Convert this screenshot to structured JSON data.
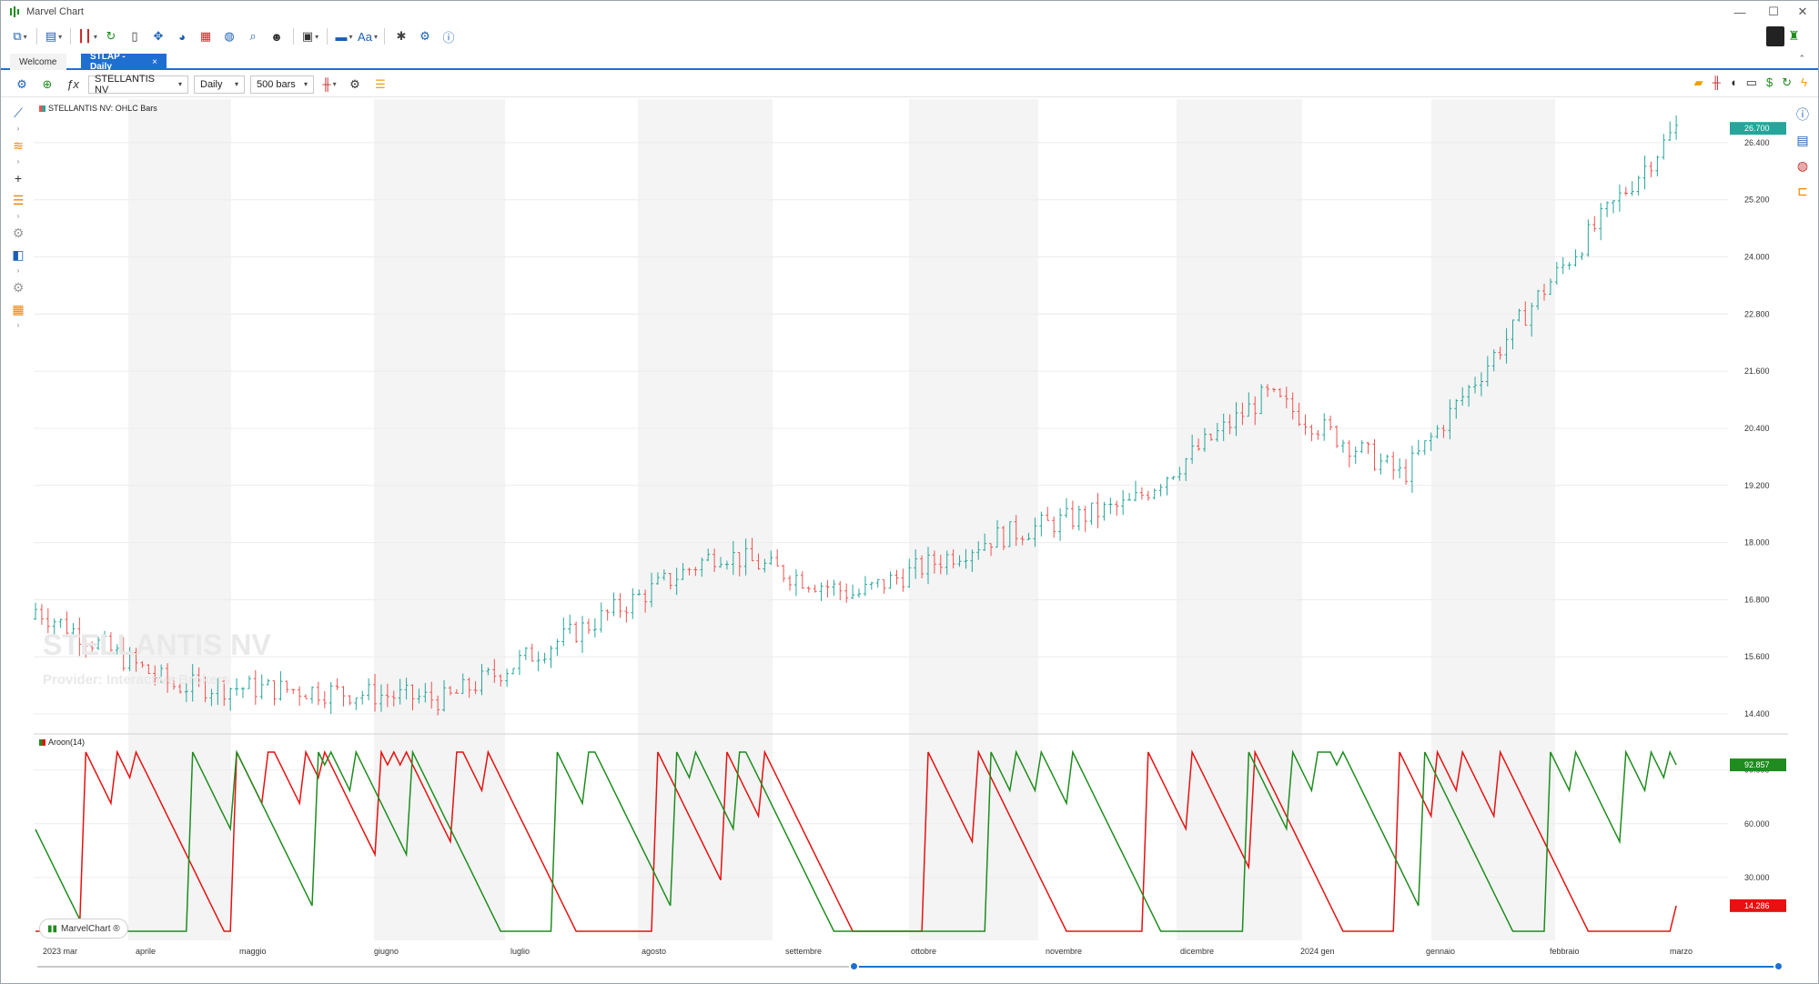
{
  "window": {
    "title": "Marvel Chart",
    "minimize_label": "—",
    "maximize_label": "☐",
    "close_label": "✕"
  },
  "toolbar": {
    "icons": [
      "tree-icon",
      "layout-icon",
      "candles-icon",
      "history-icon",
      "document-icon",
      "move-icon",
      "pie-icon",
      "calendar-icon",
      "globe-icon",
      "search-icon",
      "user-icon",
      "screen-icon",
      "bar-icon",
      "font-icon",
      "bug-icon",
      "gear-icon",
      "info-icon"
    ],
    "font_label": "Aa"
  },
  "tabs": [
    {
      "label": "Welcome",
      "active": false
    },
    {
      "label": "STLAP - Daily",
      "active": true,
      "close": "×"
    }
  ],
  "chartbar": {
    "symbol": "STELLANTIS NV",
    "timeframe": "Daily",
    "bars": "500 bars"
  },
  "price_panel": {
    "legend": "STELLANTIS NV: OHLC Bars",
    "watermark_title": "STELLANTIS NV",
    "watermark_provider": "Provider: Interactive Brokers",
    "last_price": "26.700",
    "y_ticks": [
      "26.400",
      "25.200",
      "24.000",
      "22.800",
      "21.600",
      "20.400",
      "19.200",
      "18.000",
      "16.800",
      "15.600",
      "14.400"
    ]
  },
  "indicator_panel": {
    "legend": "Aroon(14)",
    "up_value": "92.857",
    "down_value": "14.286",
    "y_ticks": [
      "90.000",
      "60.000",
      "30.000"
    ]
  },
  "x_axis": {
    "labels": [
      "2023 mar",
      "aprile",
      "maggio",
      "giugno",
      "luglio",
      "agosto",
      "settembre",
      "ottobre",
      "novembre",
      "dicembre",
      "2024 gen",
      "gennaio",
      "febbraio",
      "marzo"
    ]
  },
  "badge": {
    "label": "MarvelChart ®"
  },
  "colors": {
    "up": "#26a69a",
    "down": "#ef5350",
    "aroon_up": "#1e8c1e",
    "aroon_down": "#e81010",
    "accent": "#1f6fd1",
    "band": "#f4f4f4"
  },
  "chart_data": {
    "type": "ohlc",
    "title": "STELLANTIS NV: OHLC Bars",
    "x": [
      "2023-03",
      "2023-04",
      "2023-05",
      "2023-06",
      "2023-07",
      "2023-08",
      "2023-09",
      "2023-10",
      "2023-11",
      "2023-12",
      "2024-01",
      "2024-02",
      "2024-03"
    ],
    "series": [
      {
        "name": "STELLANTIS NV",
        "close": [
          16.6,
          15.0,
          14.9,
          14.7,
          16.2,
          17.8,
          16.9,
          18.1,
          18.8,
          21.1,
          19.4,
          23.2,
          26.7
        ]
      },
      {
        "name": "Aroon Up",
        "last": 92.857
      },
      {
        "name": "Aroon Down",
        "last": 14.286
      }
    ],
    "ylim": [
      14.0,
      27.2
    ],
    "indicator_ylim": [
      0,
      100
    ],
    "indicator": "Aroon(14)"
  }
}
